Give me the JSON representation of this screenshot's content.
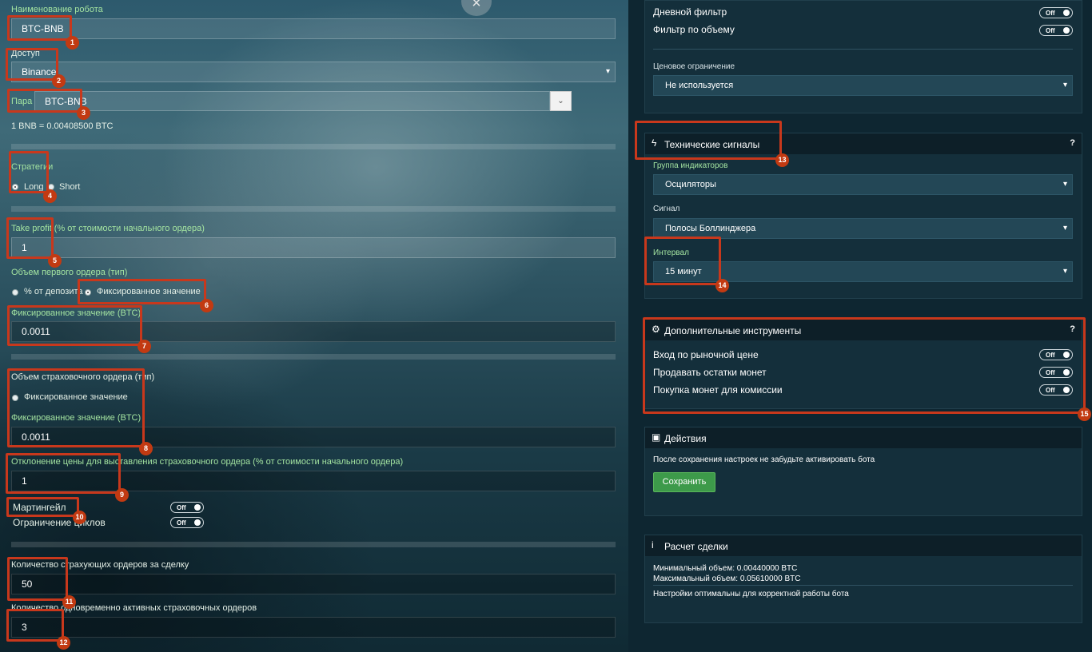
{
  "form": {
    "robot_name_label": "Наименование робота",
    "robot_name_value": "BTC-BNB",
    "access_label": "Доступ",
    "access_value": "Binance",
    "pair_label": "Пара",
    "pair_value": "BTC-BNB",
    "rate_text": "1 BNB = 0.00408500 BTC",
    "strategy_label": "Стратегии",
    "strategy_long": "Long",
    "strategy_short": "Short",
    "take_profit_label": "Take profit (% от стоимости начального ордера)",
    "take_profit_value": "1",
    "first_order_label": "Объем первого ордера (тип)",
    "first_order_opt_percent": "% от депозита",
    "first_order_opt_fixed": "Фиксированное значение",
    "fixed_value_label": "Фиксированное значение (BTC)",
    "fixed_value_value": "0.0011",
    "safety_order_label": "Объем страховочного ордера (тип)",
    "safety_order_opt_fixed": "Фиксированное значение",
    "safety_fixed_label": "Фиксированное значение (BTC)",
    "safety_fixed_value": "0.0011",
    "deviation_label": "Отклонение цены для выставления страховочного ордера (% от стоимости начального ордера)",
    "deviation_value": "1",
    "martingale_label": "Мартингейл",
    "martingale_state": "Off",
    "cycles_label": "Ограничение циклов",
    "cycles_state": "Off",
    "safety_count_label": "Количество страхующих ордеров за сделку",
    "safety_count_value": "50",
    "active_safety_label": "Количество одновременно активных страховочных ордеров",
    "active_safety_value": "3"
  },
  "close_icon": "×",
  "right": {
    "daily_filter_label": "Дневной фильтр",
    "daily_filter_state": "Off",
    "volume_filter_label": "Фильтр по объему",
    "volume_filter_state": "Off",
    "price_limit_label": "Ценовое ограничение",
    "price_limit_value": "Не используется",
    "signals": {
      "title": "Технические сигналы",
      "help": "?",
      "icon": "lightning-icon",
      "group_label": "Группа индикаторов",
      "group_value": "Осциляторы",
      "signal_label": "Сигнал",
      "signal_value": "Полосы Боллинджера",
      "interval_label": "Интервал",
      "interval_value": "15 минут"
    },
    "tools": {
      "title": "Дополнительные инструменты",
      "help": "?",
      "icon": "gears-icon",
      "market_entry_label": "Вход по рыночной цене",
      "market_entry_state": "Off",
      "sell_remains_label": "Продавать остатки монет",
      "sell_remains_state": "Off",
      "buy_fee_label": "Покупка монет для комиссии",
      "buy_fee_state": "Off"
    },
    "actions": {
      "title": "Действия",
      "icon": "floppy-disk-icon",
      "note": "После сохранения настроек не забудьте активировать бота",
      "save_label": "Сохранить"
    },
    "calc": {
      "title": "Расчет сделки",
      "icon": "info-icon",
      "min_volume": "Минимальный объем: 0.00440000 BTC",
      "max_volume": "Максимальный объем: 0.05610000 BTC",
      "status": "Настройки оптимальны для корректной работы бота"
    }
  },
  "annotations": [
    "1",
    "2",
    "3",
    "4",
    "5",
    "6",
    "7",
    "8",
    "9",
    "10",
    "11",
    "12",
    "13",
    "14",
    "15"
  ],
  "colors": {
    "highlight": "#c8381c",
    "badge": "#c23a12",
    "green_label": "#a3e3a0",
    "save_button": "#3d9a4a"
  }
}
